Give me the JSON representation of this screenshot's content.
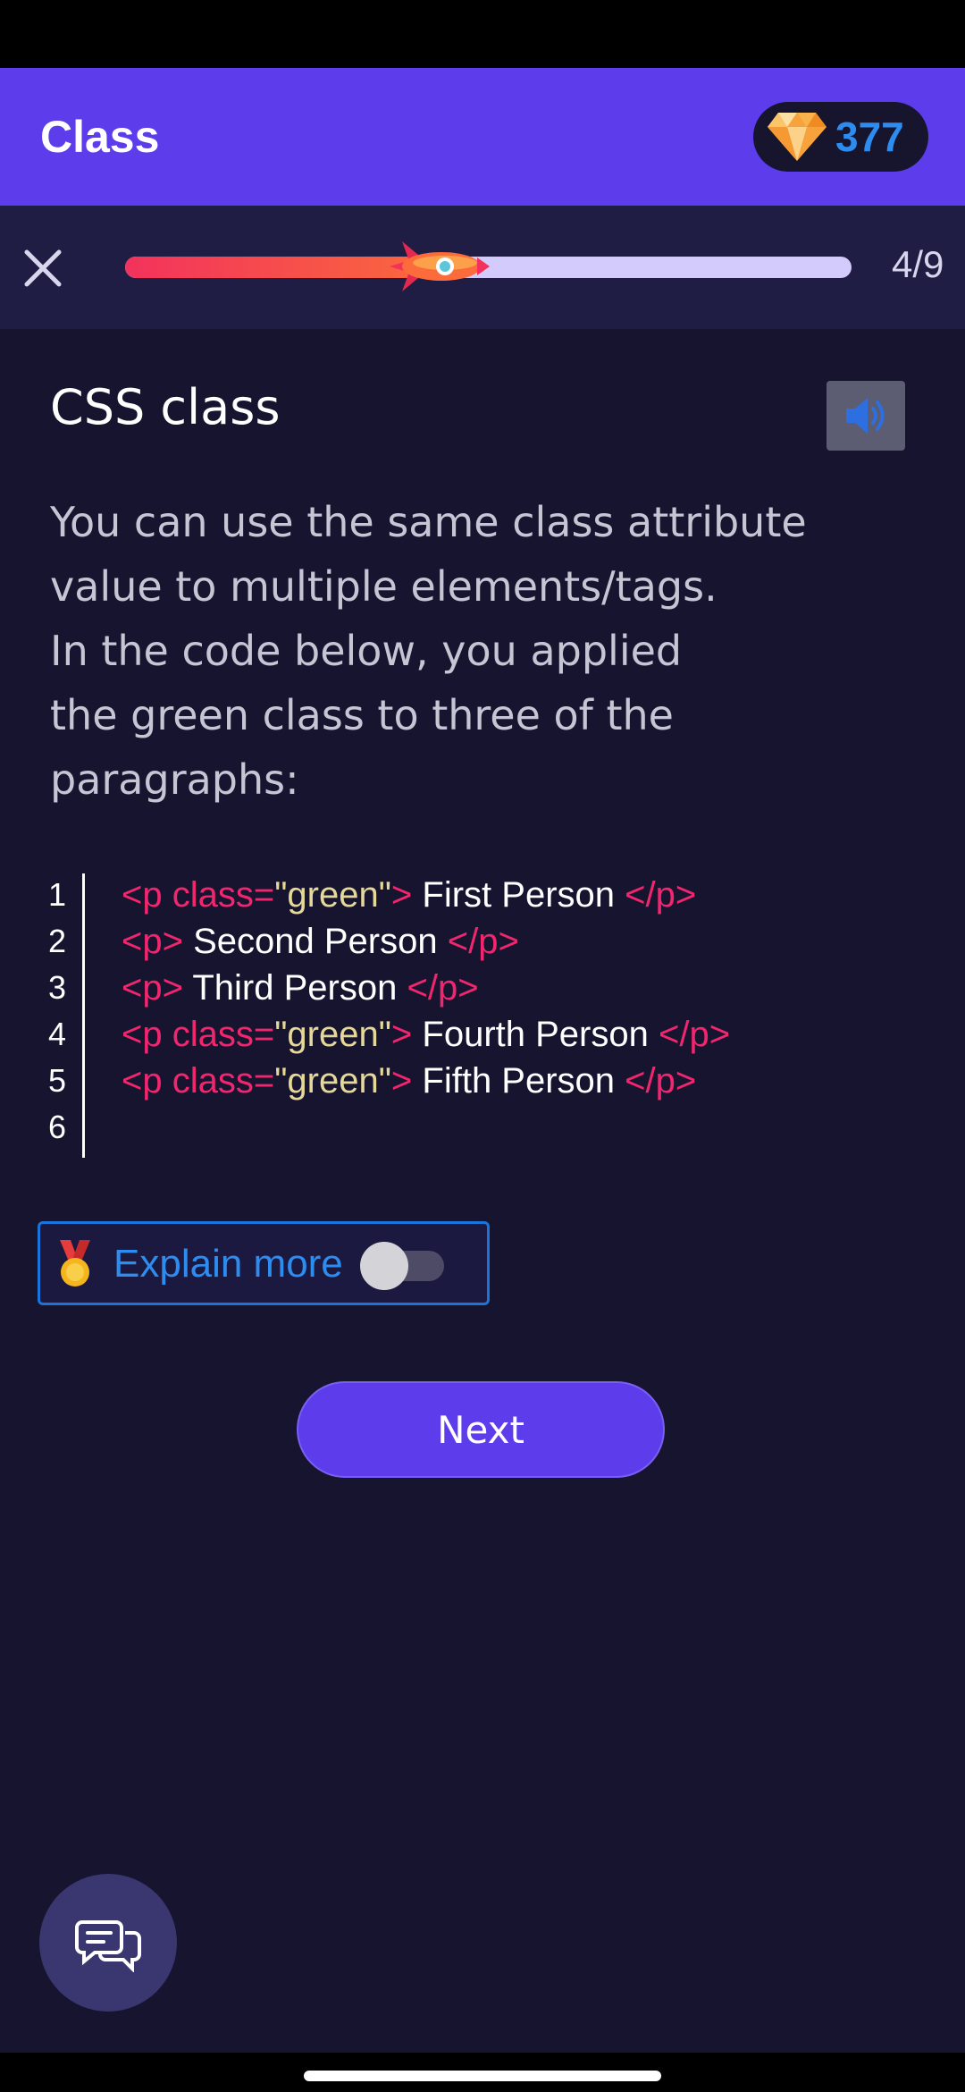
{
  "header": {
    "title": "Class",
    "gem_count": "377",
    "gem_icon": "diamond-icon"
  },
  "progress": {
    "text": "4/9",
    "fraction": 0.45,
    "close_icon": "close-icon",
    "marker_icon": "rocket-icon"
  },
  "lesson": {
    "title": "CSS class",
    "audio_icon": "speaker-icon",
    "body": "You can use the same class attribute\nvalue to multiple elements/tags.\nIn the code below, you applied\nthe green class to three of the\nparagraphs:"
  },
  "code": {
    "lines": [
      {
        "no": "1",
        "tokens": [
          {
            "t": "tag",
            "v": "<p class="
          },
          {
            "t": "str",
            "v": "\"green\""
          },
          {
            "t": "tag",
            "v": ">"
          },
          {
            "t": "txt",
            "v": " First Person "
          },
          {
            "t": "tag",
            "v": "</p>"
          }
        ]
      },
      {
        "no": "2",
        "tokens": [
          {
            "t": "tag",
            "v": "<p>"
          },
          {
            "t": "txt",
            "v": " Second Person "
          },
          {
            "t": "tag",
            "v": "</p>"
          }
        ]
      },
      {
        "no": "3",
        "tokens": [
          {
            "t": "tag",
            "v": "<p>"
          },
          {
            "t": "txt",
            "v": " Third Person "
          },
          {
            "t": "tag",
            "v": "</p>"
          }
        ]
      },
      {
        "no": "4",
        "tokens": [
          {
            "t": "tag",
            "v": "<p class="
          },
          {
            "t": "str",
            "v": "\"green\""
          },
          {
            "t": "tag",
            "v": ">"
          },
          {
            "t": "txt",
            "v": " Fourth Person "
          },
          {
            "t": "tag",
            "v": "</p>"
          }
        ]
      },
      {
        "no": "5",
        "tokens": [
          {
            "t": "tag",
            "v": "<p class="
          },
          {
            "t": "str",
            "v": "\"green\""
          },
          {
            "t": "tag",
            "v": ">"
          },
          {
            "t": "txt",
            "v": " Fifth Person "
          },
          {
            "t": "tag",
            "v": "</p>"
          }
        ]
      },
      {
        "no": "6",
        "tokens": []
      }
    ]
  },
  "explain": {
    "label": "Explain more",
    "toggle_on": false,
    "icon": "medal-icon"
  },
  "actions": {
    "next_label": "Next"
  },
  "chat": {
    "icon": "chat-bubbles-icon"
  },
  "colors": {
    "accent": "#5c3ceb",
    "background": "#16142f",
    "tag": "#f2266e",
    "string": "#e6d898",
    "link_blue": "#2d8cf0"
  }
}
